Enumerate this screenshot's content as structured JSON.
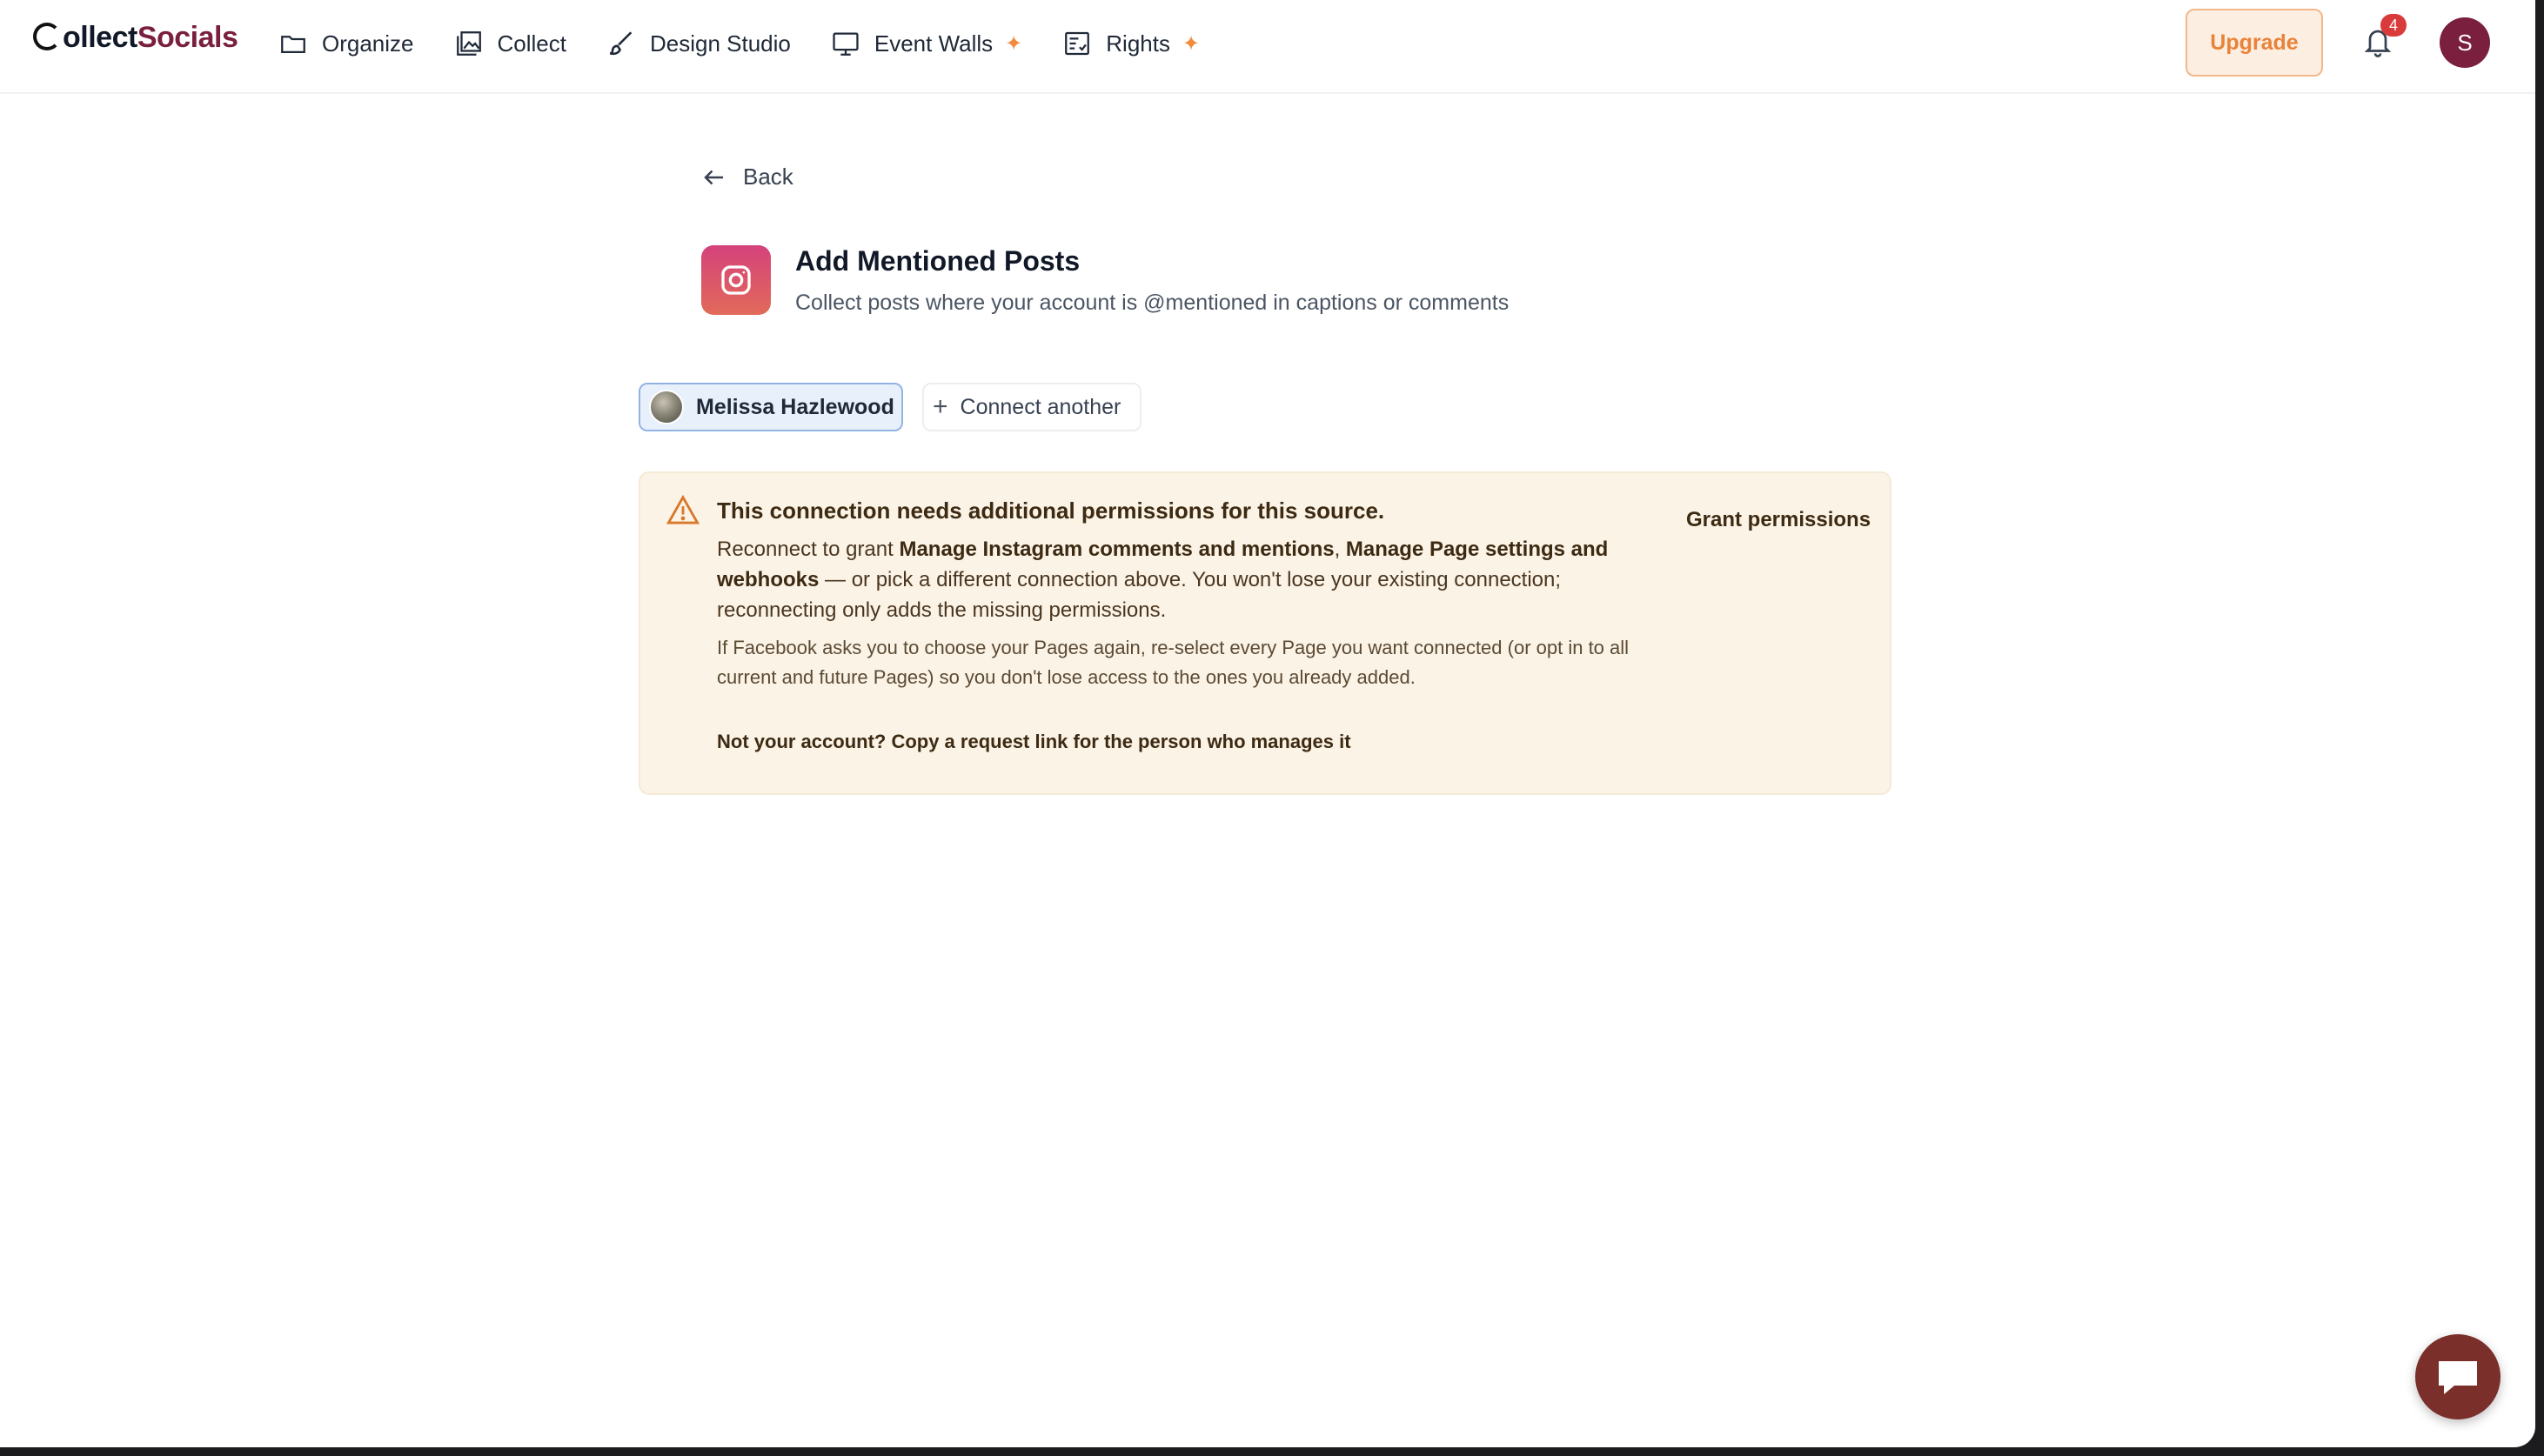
{
  "app": {
    "logo_part1": "ollect",
    "logo_part2": "Socials"
  },
  "nav": {
    "items": [
      {
        "label": "Organize",
        "icon": "folder-icon"
      },
      {
        "label": "Collect",
        "icon": "gallery-icon"
      },
      {
        "label": "Design Studio",
        "icon": "brush-icon"
      },
      {
        "label": "Event Walls",
        "icon": "monitor-icon",
        "sparkle": true
      },
      {
        "label": "Rights",
        "icon": "checklist-icon",
        "sparkle": true
      }
    ],
    "upgrade_label": "Upgrade",
    "notification_count": "4",
    "user_initial": "S"
  },
  "page": {
    "back_label": "Back",
    "title": "Add Mentioned Posts",
    "subtitle": "Collect posts where your account is @mentioned in captions or comments",
    "source_icon": "instagram-icon"
  },
  "connections": {
    "selected_account": "Melissa Hazlewood",
    "connect_another_label": "Connect another"
  },
  "alert": {
    "title": "This connection needs additional permissions for this source.",
    "body_prefix": "Reconnect to grant ",
    "perm1": "Manage Instagram comments and mentions",
    "sep": ", ",
    "perm2": "Manage Page settings and webhooks",
    "body_suffix": " — or pick a different connection above. You won't lose your existing connection; reconnecting only adds the missing permissions.",
    "note": "If Facebook asks you to choose your Pages again, re-select every Page you want connected (or opt in to all current and future Pages) so you don't lose access to the ones you already added.",
    "request_link": "Not your account? Copy a request link for the person who manages it",
    "grant_label": "Grant permissions"
  },
  "colors": {
    "brand": "#7a1f3d",
    "accent_orange": "#e8833a",
    "alert_bg": "#fbf3e6",
    "selected_chip_bg": "#e8f0fc"
  }
}
